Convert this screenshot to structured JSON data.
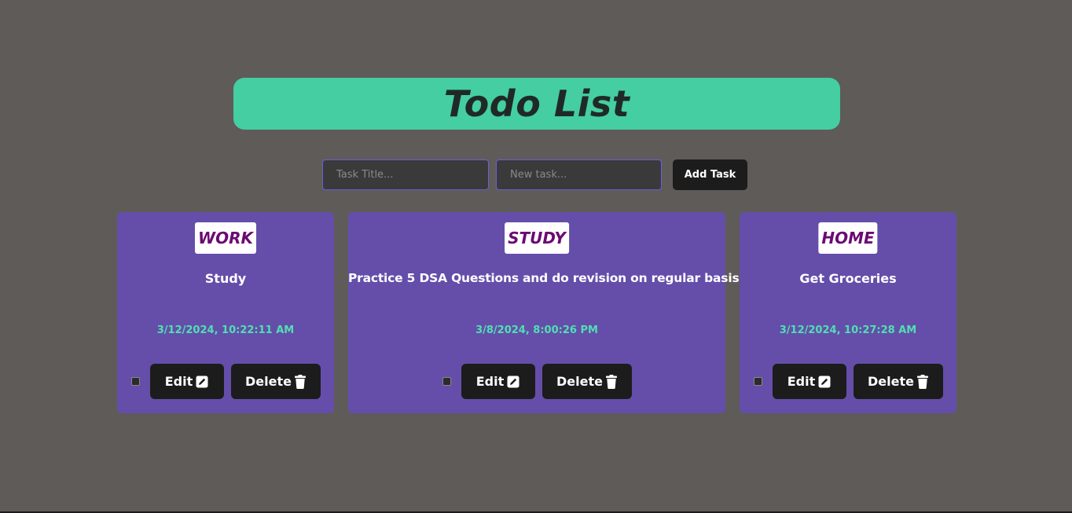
{
  "header": {
    "title": "Todo List"
  },
  "form": {
    "title_placeholder": "Task Title...",
    "task_placeholder": "New task...",
    "add_label": "Add Task"
  },
  "cards": [
    {
      "tag": "WORK",
      "text": "Study",
      "timestamp": "3/12/2024, 10:22:11 AM",
      "edit_label": "Edit",
      "delete_label": "Delete"
    },
    {
      "tag": "STUDY",
      "text": "Practice 5 DSA Questions and do revision on regular basis",
      "timestamp": "3/8/2024, 8:00:26 PM",
      "edit_label": "Edit",
      "delete_label": "Delete"
    },
    {
      "tag": "HOME",
      "text": "Get Groceries",
      "timestamp": "3/12/2024, 10:27:28 AM",
      "edit_label": "Edit",
      "delete_label": "Delete"
    }
  ],
  "icons": {
    "edit": "pencil-square-icon",
    "delete": "trash-icon"
  },
  "colors": {
    "background": "#5f5b59",
    "banner": "#44cea1",
    "card": "#654eaa",
    "tag_text": "#6b0a74",
    "timestamp": "#4fe0b2",
    "button": "#1c1c1c"
  }
}
